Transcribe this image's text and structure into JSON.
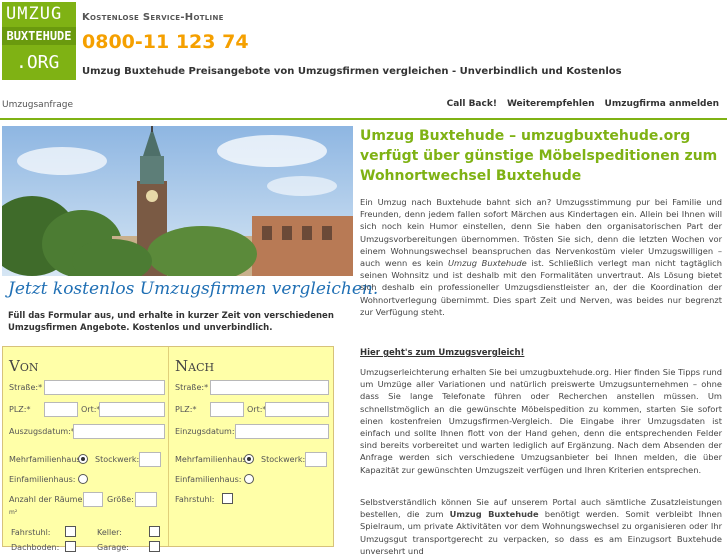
{
  "logo": {
    "line1": "UMZUG",
    "line2": "BUXTEHUDE",
    "line3": ".ORG"
  },
  "hotline": {
    "title": "Kostenlose Service-Hotline",
    "number": "0800-11 123 74"
  },
  "tagline": "Umzug Buxtehude Preisangebote von Umzugsfirmen vergleichen - Unverbindlich und Kostenlos",
  "nav": {
    "breadcrumb": "Umzugsanfrage",
    "links": [
      "Call Back!",
      "Weiterempfehlen",
      "Umzugfirma anmelden"
    ]
  },
  "banner": "Jetzt kostenlos Umzugsfirmen vergleichen.",
  "intro": "Füll das Formular aus, und erhalte in kurzer Zeit von verschiedenen Umzugsfirmen Angebote. Kostenlos und unverbindlich.",
  "form": {
    "from": {
      "title": "Von",
      "street": "Straße:*",
      "plz": "PLZ:*",
      "ort": "Ort:*",
      "date": "Auszugsdatum:*",
      "mfh": "Mehrfamilienhaus:",
      "stockwerk": "Stockwerk:",
      "efh": "Einfamilienhaus:",
      "rooms": "Anzahl der Räume:",
      "size": "Größe:",
      "unit": "m²",
      "elevator": "Fahrstuhl:",
      "cellar": "Keller:",
      "attic": "Dachboden:",
      "garage": "Garage:"
    },
    "to": {
      "title": "Nach",
      "street": "Straße:*",
      "plz": "PLZ:*",
      "ort": "Ort:*",
      "date": "Einzugsdatum:*",
      "mfh": "Mehrfamilienhaus:",
      "stockwerk": "Stockwerk:",
      "efh": "Einfamilienhaus:",
      "elevator": "Fahrstuhl:"
    }
  },
  "article": {
    "headline": "Umzug Buxtehude – umzugbuxtehude.org verfügt über günstige Möbelspeditionen zum Wohnortwechsel Buxtehude",
    "p1a": "Ein Umzug nach Buxtehude bahnt sich an? Umzugsstimmung pur bei Familie und Freunden, denn jedem fallen sofort Märchen aus Kindertagen ein. Allein bei Ihnen will sich noch kein Humor einstellen, denn Sie haben den organisatorischen Part der Umzugsvorbereitungen übernommen. Trösten Sie sich, denn die letzten Wochen vor einem Wohnungswechsel beanspruchen das Nervenkostüm vieler Umzugswilligen – auch wenn es kein ",
    "p1em": "Umzug Buxtehude",
    "p1b": " ist. Schließlich verlegt man nicht tagtäglich seinen Wohnsitz und ist deshalb mit den Formalitäten unvertraut. Als Lösung bietet sich deshalb ein professioneller Umzugsdienstleister an, der die Koordination der Wohnortverlegung übernimmt. Dies spart Zeit und Nerven, was beides nur begrenzt zur Verfügung steht.",
    "link": "Hier geht's zum Umzugsvergleich!",
    "p2": "Umzugserleichterung erhalten Sie bei umzugbuxtehude.org. Hier finden Sie Tipps rund um Umzüge aller Variationen und natürlich preiswerte Umzugsunternehmen – ohne dass Sie lange Telefonate führen oder Recherchen anstellen müssen. Um schnellstmöglich an die gewünschte Möbelspedition zu kommen, starten Sie sofort einen kostenfreien Umzugsfirmen-Vergleich. Die Eingabe ihrer Umzugsdaten ist einfach und sollte Ihnen flott von der Hand gehen, denn die entsprechenden Felder sind bereits vorbereitet und warten lediglich auf Ergänzung. Nach dem Absenden der Anfrage werden sich verschiedene Umzugsanbieter bei Ihnen melden, die über Kapazität zur gewünschten Umzugszeit verfügen und Ihren Kriterien entsprechen.",
    "p3a": "Selbstverständlich können Sie auf unserem Portal auch sämtliche Zusatzleistungen bestellen, die zum ",
    "p3b": "Umzug Buxtehude",
    "p3c": " benötigt werden. Somit verbleibt Ihnen Spielraum, um private Aktivitäten vor dem Wohnungswechsel zu organisieren oder Ihr Umzugsgut transportgerecht zu verpacken, so dass es am Einzugsort Buxtehude unversehrt und"
  }
}
